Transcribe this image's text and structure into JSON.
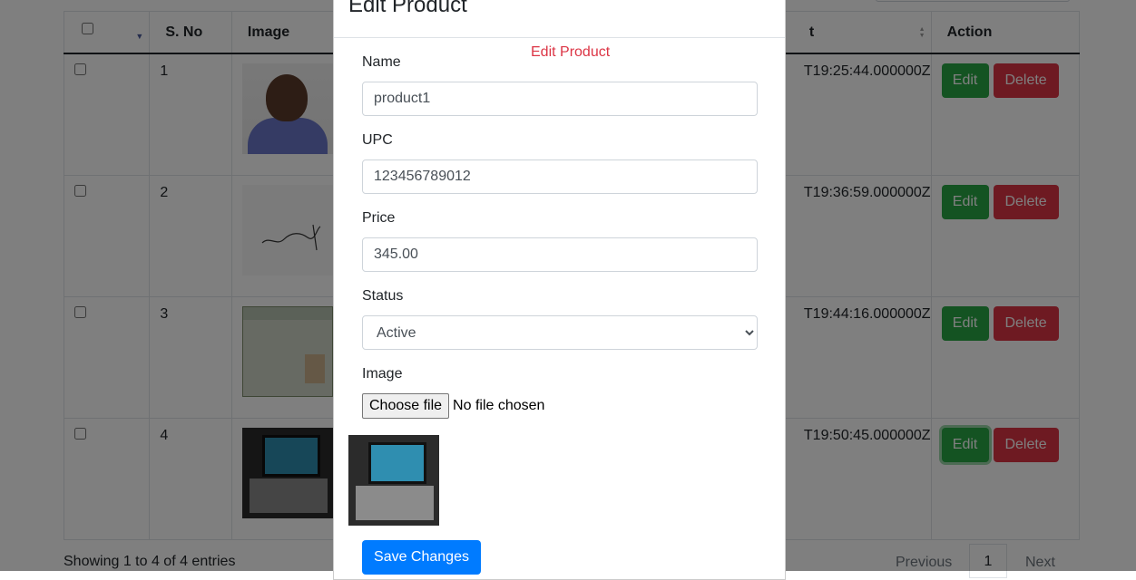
{
  "table": {
    "headers": {
      "select_all": "",
      "sno": "S. No",
      "image": "Image",
      "created_partial": "t",
      "action": "Action"
    },
    "rows": [
      {
        "sno": "1",
        "created": "T19:25:44.000000Z",
        "edit": "Edit",
        "delete": "Delete",
        "image_icon": "person-photo"
      },
      {
        "sno": "2",
        "created": "T19:36:59.000000Z",
        "edit": "Edit",
        "delete": "Delete",
        "image_icon": "signature-image"
      },
      {
        "sno": "3",
        "created": "T19:44:16.000000Z",
        "edit": "Edit",
        "delete": "Delete",
        "image_icon": "id-card-image"
      },
      {
        "sno": "4",
        "created": "T19:50:45.000000Z",
        "edit": "Edit",
        "delete": "Delete",
        "image_icon": "laptop-image"
      }
    ],
    "footer": "Showing 1 to 4 of 4 entries",
    "pagination": {
      "previous": "Previous",
      "current": "1",
      "next": "Next"
    }
  },
  "modal": {
    "title": "Edit Product",
    "error": "Edit Product",
    "name": {
      "label": "Name",
      "value": "product1"
    },
    "upc": {
      "label": "UPC",
      "value": "123456789012"
    },
    "price": {
      "label": "Price",
      "value": "345.00"
    },
    "status": {
      "label": "Status",
      "selected": "Active"
    },
    "image": {
      "label": "Image",
      "button": "Choose file",
      "status": "No file chosen",
      "preview_icon": "laptop-image"
    },
    "save": "Save Changes"
  },
  "colors": {
    "primary": "#007bff",
    "success": "#28a745",
    "danger": "#dc3545",
    "overlay": "rgba(0,0,0,0.5)"
  }
}
